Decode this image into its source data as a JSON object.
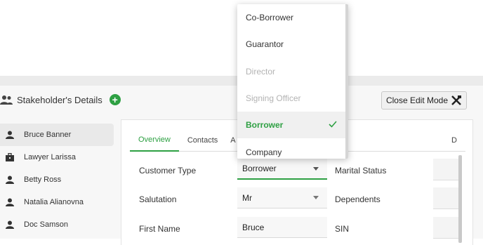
{
  "header": {
    "title": "Stakeholder's Details",
    "close_edit_label": "Close Edit Mode"
  },
  "sidebar": {
    "items": [
      {
        "label": "Bruce Banner",
        "icon": "person-icon",
        "active": true
      },
      {
        "label": "Lawyer Larissa",
        "icon": "briefcase-icon",
        "active": false
      },
      {
        "label": "Betty Ross",
        "icon": "person-icon",
        "active": false
      },
      {
        "label": "Natalia Alianovna",
        "icon": "person-icon",
        "active": false
      },
      {
        "label": "Doc Samson",
        "icon": "person-icon",
        "active": false
      }
    ]
  },
  "tabs": [
    {
      "label": "Overview",
      "active": true
    },
    {
      "label": "Contacts",
      "active": false
    },
    {
      "label": "A",
      "active": false
    },
    {
      "label": "D",
      "active": false
    }
  ],
  "form": {
    "customer_type_label": "Customer Type",
    "customer_type_value": "Borrower",
    "salutation_label": "Salutation",
    "salutation_value": "Mr",
    "first_name_label": "First Name",
    "first_name_value": "Bruce",
    "marital_status_label": "Marital Status",
    "dependents_label": "Dependents",
    "sin_label": "SIN"
  },
  "dropdown": {
    "options": [
      {
        "label": "Co-Borrower",
        "state": "enabled"
      },
      {
        "label": "Guarantor",
        "state": "enabled"
      },
      {
        "label": "Director",
        "state": "disabled"
      },
      {
        "label": "Signing Officer",
        "state": "disabled"
      },
      {
        "label": "Borrower",
        "state": "selected"
      },
      {
        "label": "Company",
        "state": "enabled"
      }
    ]
  },
  "colors": {
    "accent": "#2ea043",
    "disabled_text": "#b3b3b3"
  }
}
